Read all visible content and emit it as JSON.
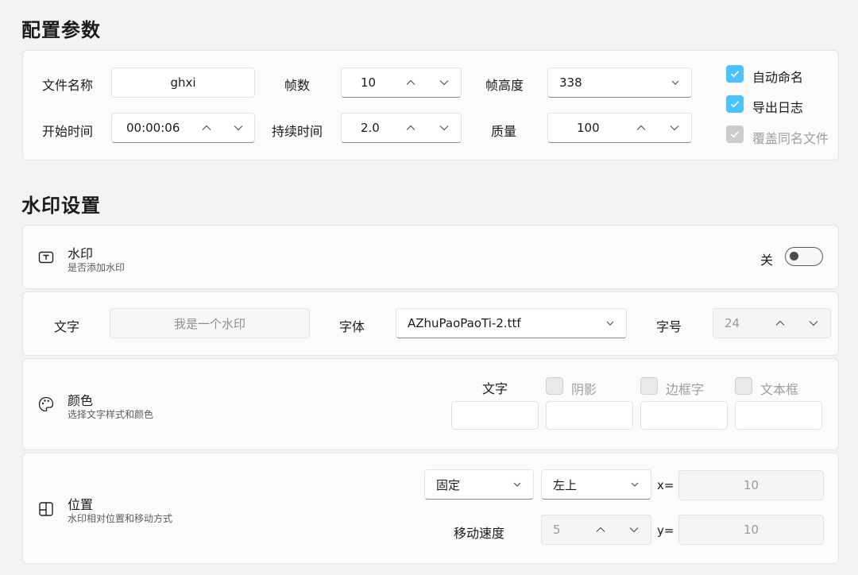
{
  "config": {
    "title": "配置参数",
    "filename_label": "文件名称",
    "filename_value": "ghxi",
    "frames_label": "帧数",
    "frames_value": "10",
    "frame_height_label": "帧高度",
    "frame_height_value": "338",
    "start_time_label": "开始时间",
    "start_time_value": "00:00:06",
    "duration_label": "持续时间",
    "duration_value": "2.0",
    "quality_label": "质量",
    "quality_value": "100",
    "auto_name_label": "自动命名",
    "auto_name_checked": true,
    "export_log_label": "导出日志",
    "export_log_checked": true,
    "overwrite_label": "覆盖同名文件",
    "overwrite_checked": true
  },
  "watermark": {
    "title": "水印设置",
    "toggle_title": "水印",
    "toggle_desc": "是否添加水印",
    "toggle_state_label": "关",
    "toggle_on": false,
    "text_label": "文字",
    "text_placeholder": "我是一个水印",
    "font_label": "字体",
    "font_value": "AZhuPaoPaoTi-2.ttf",
    "size_label": "字号",
    "size_value": "24",
    "color_title": "颜色",
    "color_desc": "选择文字样式和颜色",
    "color_text_label": "文字",
    "shadow_label": "阴影",
    "border_text_label": "边框字",
    "text_box_label": "文本框",
    "position_title": "位置",
    "position_desc": "水印相对位置和移动方式",
    "mode_value": "固定",
    "anchor_value": "左上",
    "x_label": "x=",
    "x_value": "10",
    "speed_label": "移动速度",
    "speed_value": "5",
    "y_label": "y=",
    "y_value": "10"
  }
}
